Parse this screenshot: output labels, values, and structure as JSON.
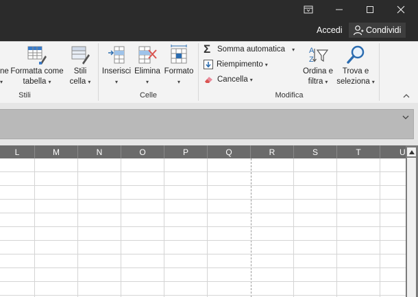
{
  "titlebar": {
    "sign_in": "Accedi",
    "share": "Condividi"
  },
  "ribbon": {
    "stili": {
      "partial_label_1": "ne",
      "format_as_table_line1": "Formatta come",
      "format_as_table_line2": "tabella",
      "cell_styles_line1": "Stili",
      "cell_styles_line2": "cella",
      "group_label": "Stili"
    },
    "celle": {
      "insert": "Inserisci",
      "delete": "Elimina",
      "format": "Formato",
      "group_label": "Celle"
    },
    "modifica": {
      "autosum": "Somma automatica",
      "fill": "Riempimento",
      "clear": "Cancella",
      "sort_filter_line1": "Ordina e",
      "sort_filter_line2": "filtra",
      "find_select_line1": "Trova e",
      "find_select_line2": "seleziona",
      "group_label": "Modifica"
    }
  },
  "sheet": {
    "columns": [
      "L",
      "M",
      "N",
      "O",
      "P",
      "Q",
      "R",
      "S",
      "T",
      "U"
    ]
  },
  "colors": {
    "titlebar_bg": "#2b2b2b",
    "ribbon_bg": "#f3f3f3",
    "header_bg": "#6b6b6b",
    "accent_blue": "#2b6cb0",
    "accent_red": "#d9534f"
  }
}
